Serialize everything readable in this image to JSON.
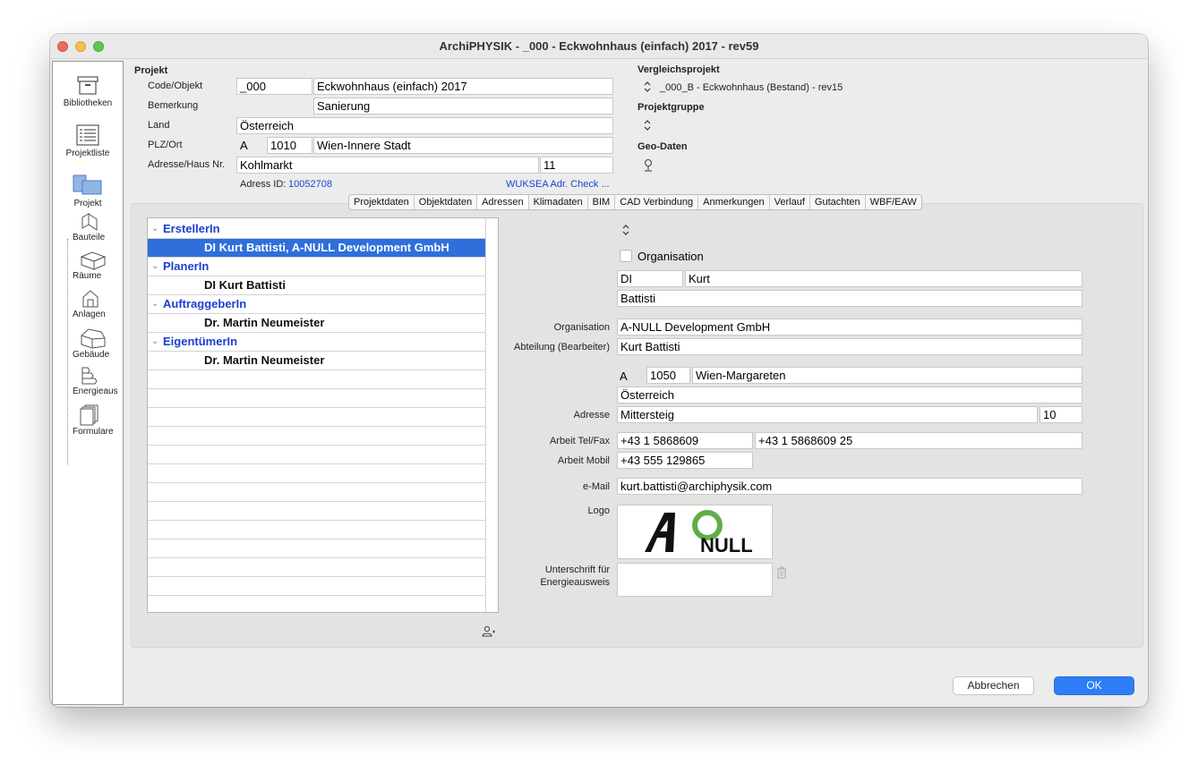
{
  "window": {
    "title": "ArchiPHYSIK - _000 - Eckwohnhaus (einfach) 2017 - rev59"
  },
  "sidebar": {
    "items": [
      {
        "label": "Bibliotheken"
      },
      {
        "label": "Projektliste"
      },
      {
        "label": "Projekt"
      }
    ],
    "subitems": [
      {
        "label": "Bauteile"
      },
      {
        "label": "Räume"
      },
      {
        "label": "Anlagen"
      },
      {
        "label": "Gebäude"
      },
      {
        "label": "Energieaus"
      },
      {
        "label": "Formulare"
      }
    ]
  },
  "project": {
    "heading": "Projekt",
    "code_label": "Code/Objekt",
    "code_value": "_000",
    "object_value": "Eckwohnhaus (einfach) 2017",
    "remark_label": "Bemerkung",
    "remark_value": "Sanierung",
    "country_label": "Land",
    "country_value": "Österreich",
    "zip_label": "PLZ/Ort",
    "country_code": "A",
    "zip_value": "1010",
    "city_value": "Wien-Innere Stadt",
    "address_label": "Adresse/Haus Nr.",
    "street_value": "Kohlmarkt",
    "house_no_value": "11",
    "address_id_label": "Adress ID:",
    "address_id_value": "10052708",
    "wuksea_link": "WUKSEA Adr. Check ..."
  },
  "right": {
    "compare_heading": "Vergleichsprojekt",
    "compare_value": "_000_B - Eckwohnhaus (Bestand) - rev15",
    "group_heading": "Projektgruppe",
    "geo_heading": "Geo-Daten"
  },
  "tabs": [
    {
      "label": "Projektdaten"
    },
    {
      "label": "Objektdaten"
    },
    {
      "label": "Adressen"
    },
    {
      "label": "Klimadaten"
    },
    {
      "label": "BIM"
    },
    {
      "label": "CAD Verbindung"
    },
    {
      "label": "Anmerkungen"
    },
    {
      "label": "Verlauf"
    },
    {
      "label": "Gutachten"
    },
    {
      "label": "WBF/EAW"
    }
  ],
  "roles": {
    "rows": [
      {
        "label": "ErstellerIn",
        "type": "group"
      },
      {
        "label": "DI Kurt Battisti, A-NULL Development GmbH",
        "type": "entry",
        "selected": true
      },
      {
        "label": "PlanerIn",
        "type": "group"
      },
      {
        "label": "DI Kurt Battisti",
        "type": "entry"
      },
      {
        "label": "AuftraggeberIn",
        "type": "group"
      },
      {
        "label": "Dr. Martin Neumeister",
        "type": "entry"
      },
      {
        "label": "EigentümerIn",
        "type": "group"
      },
      {
        "label": "Dr. Martin Neumeister",
        "type": "entry"
      }
    ]
  },
  "detail": {
    "organisation_checkbox_label": "Organisation",
    "title_value": "DI",
    "firstname_value": "Kurt",
    "lastname_value": "Battisti",
    "organisation_label": "Organisation",
    "organisation_value": "A-NULL Development GmbH",
    "department_label": "Abteilung (Bearbeiter)",
    "department_value": "Kurt Battisti",
    "country_code": "A",
    "zip_value": "1050",
    "city_value": "Wien-Margareten",
    "country_value": "Österreich",
    "address_label": "Adresse",
    "street_value": "Mittersteig",
    "house_no_value": "10",
    "phone_label": "Arbeit Tel/Fax",
    "phone_value": "+43 1 5868609",
    "fax_value": "+43 1 5868609 25",
    "mobile_label": "Arbeit Mobil",
    "mobile_value": "+43 555 129865",
    "email_label": "e-Mail",
    "email_value": "kurt.battisti@archiphysik.com",
    "logo_label": "Logo",
    "logo_text": "A NULL",
    "signature_label_1": "Unterschrift für",
    "signature_label_2": "Energieausweis"
  },
  "footer": {
    "cancel_label": "Abbrechen",
    "ok_label": "OK"
  },
  "colors": {
    "accent": "#2e7df6",
    "selection": "#2f6fdb",
    "group_text": "#1a3fd1",
    "link": "#1a45d6",
    "logo_green": "#5fae46"
  }
}
